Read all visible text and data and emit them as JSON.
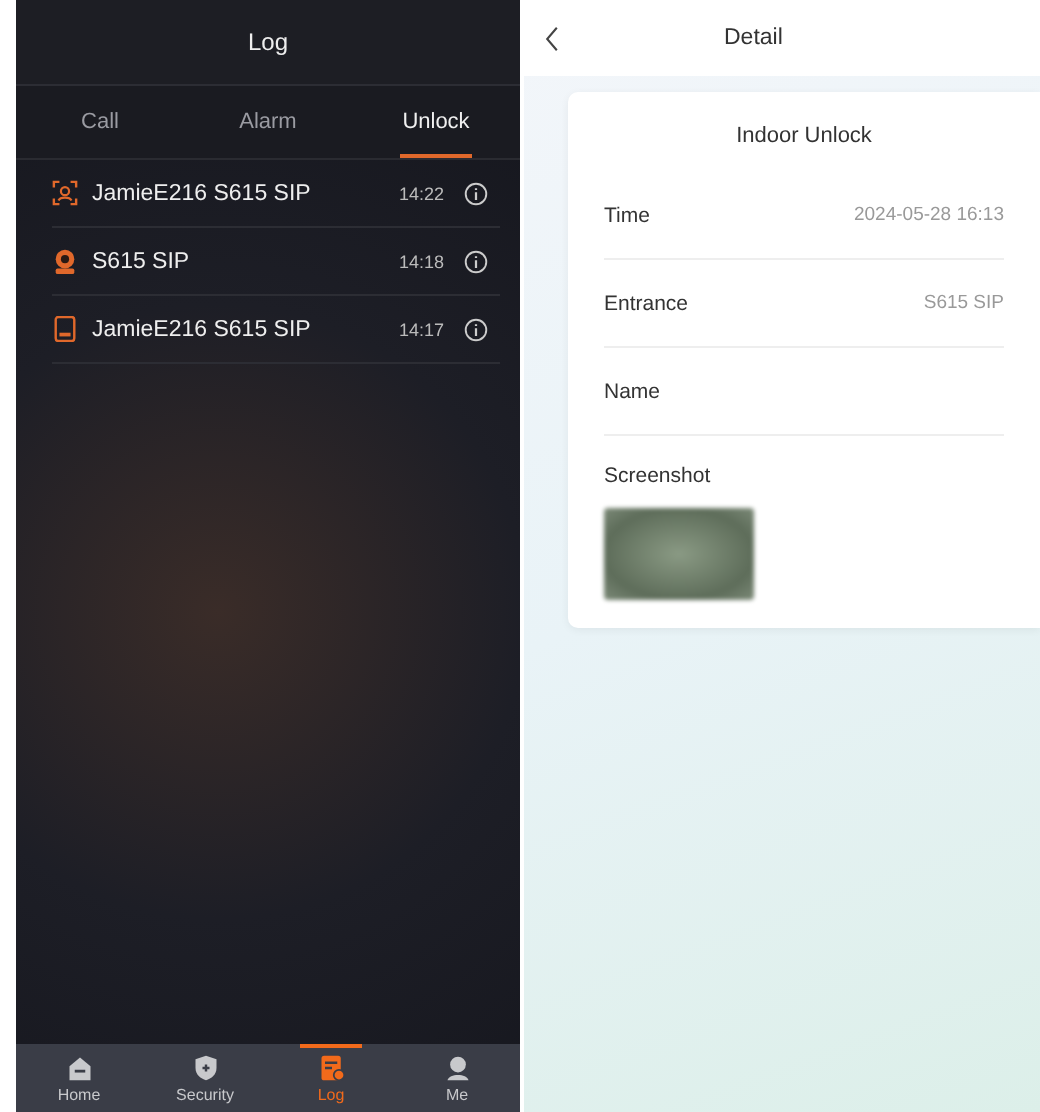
{
  "log_screen": {
    "title": "Log",
    "tabs": [
      {
        "label": "Call",
        "selected": false
      },
      {
        "label": "Alarm",
        "selected": false
      },
      {
        "label": "Unlock",
        "selected": true
      }
    ],
    "records": [
      {
        "kind": "face",
        "name": "JamieE216 S615 SIP",
        "time": "14:22"
      },
      {
        "kind": "badge",
        "name": "S615 SIP",
        "time": "14:18"
      },
      {
        "kind": "card",
        "name": "JamieE216 S615 SIP",
        "time": "14:17"
      }
    ],
    "nav": [
      {
        "kind": "home",
        "label": "Home",
        "selected": false
      },
      {
        "kind": "security",
        "label": "Security",
        "selected": false
      },
      {
        "kind": "log",
        "label": "Log",
        "selected": true
      },
      {
        "kind": "me",
        "label": "Me",
        "selected": false
      }
    ]
  },
  "detail_screen": {
    "title": "Detail",
    "card_title": "Indoor Unlock",
    "fields": [
      {
        "label": "Time",
        "value": "2024-05-28 16:13"
      },
      {
        "label": "Entrance",
        "value": "S615 SIP"
      },
      {
        "label": "Name"
      }
    ],
    "screenshot_label": "Screenshot"
  }
}
